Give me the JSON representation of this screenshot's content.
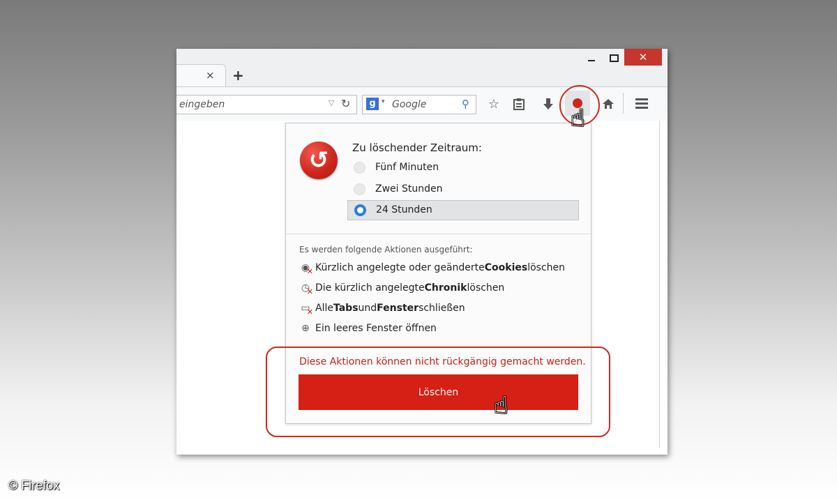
{
  "browser": {
    "tab_close": "×",
    "new_tab": "+",
    "window_close": "✕",
    "urlbar_placeholder": "eingeben",
    "url_dropdown": "▽",
    "reload": "↻",
    "search_engine_logo": "g",
    "search_caret": "▾",
    "search_placeholder": "Google",
    "search_icon": "⚲",
    "toolbar_icons": [
      "star-icon",
      "clipboard-icon",
      "download-arrow-icon",
      "forget-icon",
      "home-icon",
      "hamburger-menu-icon"
    ]
  },
  "panel": {
    "timespan_label": "Zu löschender Zeitraum:",
    "options": [
      {
        "label": "Fünf Minuten",
        "selected": false
      },
      {
        "label": "Zwei Stunden",
        "selected": false
      },
      {
        "label": "24 Stunden",
        "selected": true
      }
    ],
    "actions_heading": "Es werden folgende Aktionen ausgeführt:",
    "actions": [
      {
        "icon": "cookie-delete-icon",
        "pre": "Kürzlich angelegte oder geänderte ",
        "bold": "Cookies",
        "post": " löschen"
      },
      {
        "icon": "history-delete-icon",
        "pre": "Die kürzlich angelegte ",
        "bold": "Chronik",
        "post": " löschen"
      },
      {
        "icon": "window-close-icon",
        "pre": "Alle ",
        "bold": "Tabs",
        "mid": " und ",
        "bold2": "Fenster",
        "post": " schließen"
      },
      {
        "icon": "plus-circle-icon",
        "pre": "Ein leeres Fenster öffnen",
        "bold": "",
        "post": ""
      }
    ],
    "warning": "Diese Aktionen können nicht rückgängig gemacht werden.",
    "delete_label": "Löschen"
  },
  "credit": "© Firefox",
  "colors": {
    "accent_red": "#d61f15",
    "radio_blue": "#2a7fd6"
  }
}
